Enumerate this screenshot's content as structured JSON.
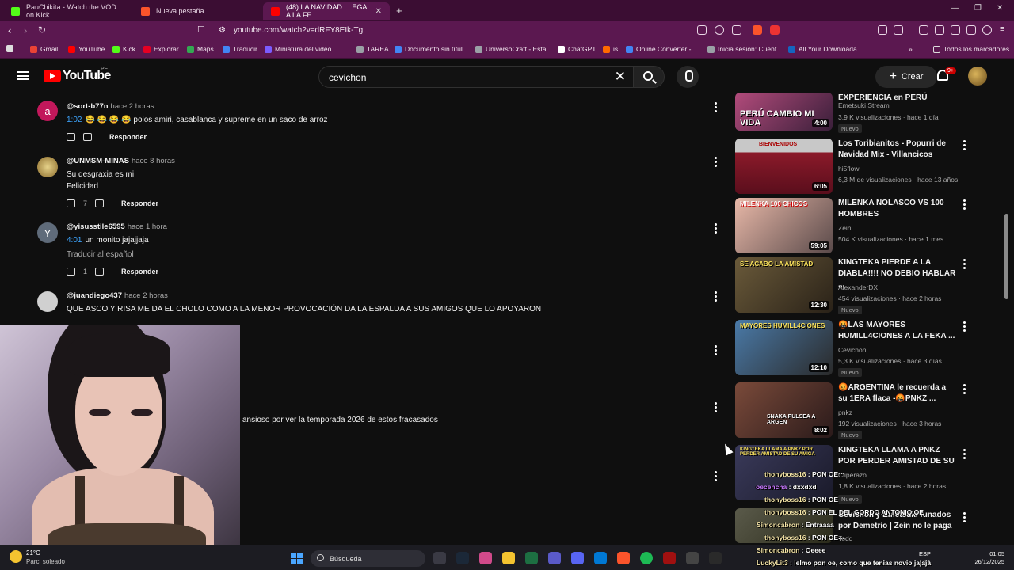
{
  "browser": {
    "tabs": [
      {
        "label": "PauChikita - Watch the VOD on Kick",
        "color": "#53fc18"
      },
      {
        "label": "Nueva pestaña",
        "color": "#fb542b"
      },
      {
        "label": "(48) LA NAVIDAD LLEGA A LA FE",
        "color": "#ff0000"
      }
    ],
    "url": "youtube.com/watch?v=dRFY8EIk-Tg",
    "bookmarks": [
      {
        "label": "Gmail",
        "color": "#ea4335"
      },
      {
        "label": "YouTube",
        "color": "#ff0000"
      },
      {
        "label": "Kick",
        "color": "#53fc18"
      },
      {
        "label": "Explorar",
        "color": "#e60023"
      },
      {
        "label": "Maps",
        "color": "#34a853"
      },
      {
        "label": "Traducir",
        "color": "#4285f4"
      },
      {
        "label": "Miniatura del video",
        "color": "#7b5cff"
      },
      {
        "label": "TAREA",
        "color": "#9aa0a6"
      },
      {
        "label": "Documento sin títul...",
        "color": "#4285f4"
      },
      {
        "label": "UniversoCraft - Esta...",
        "color": "#9aa0a6"
      },
      {
        "label": "ChatGPT",
        "color": "#ffffff"
      },
      {
        "label": "is",
        "color": "#ff6a00"
      },
      {
        "label": "Online Converter -...",
        "color": "#4285f4"
      },
      {
        "label": "Inicia sesión: Cuent...",
        "color": "#9aa0a6"
      },
      {
        "label": "All Your Downloada...",
        "color": "#1565c0"
      }
    ],
    "bookmarks_folder": "Todos los marcadores"
  },
  "youtube": {
    "logo_text": "YouTube",
    "country_code": "PE",
    "search_value": "cevichon",
    "create_label": "Crear",
    "notif_count": "9+"
  },
  "comments": [
    {
      "avatar_letter": "a",
      "avatar_color": "#c2185b",
      "user": "@sort-b77n",
      "ago": "hace 2 horas",
      "timestamp": "1:02",
      "text": "😂 😂 😂 😂 polos amiri, casablanca y supreme en un saco de arroz",
      "likes": "",
      "reply": "Responder"
    },
    {
      "avatar_letter": "",
      "avatar_color": "#b59a4a",
      "user": "@UNMSM-MINAS",
      "ago": "hace 8 horas",
      "line1": "Su desgraxia es mi",
      "line2": "Felicidad",
      "likes": "7",
      "reply": "Responder"
    },
    {
      "avatar_letter": "Y",
      "avatar_color": "#5f6b7a",
      "user": "@yisusstile6595",
      "ago": "hace 1 hora",
      "timestamp": "4:01",
      "text": "un monito jajajjaja",
      "translate": "Traducir al español",
      "likes": "1",
      "reply": "Responder"
    },
    {
      "avatar_letter": "",
      "avatar_color": "#d0d0d0",
      "user": "@juandiego437",
      "ago": "hace 2 horas",
      "text": "QUE ASCO Y RISA ME DA EL CHOLO COMO A LA MENOR PROVOCACIÓN DA LA ESPALDA A SUS AMIGOS QUE LO APOYARON",
      "reply": "Responder"
    },
    {
      "text": "ansioso por ver la temporada 2026 de estos fracasados"
    }
  ],
  "sidebar_videos": [
    {
      "title": "EXPERIENCIA en PERÚ",
      "channel": "Emetsuki Stream",
      "views": "3,9 K visualizaciones",
      "ago": "hace 1 día",
      "duration": "4:00",
      "badge": "Nuevo",
      "overlay": "PERÚ CAMBIO MI VIDA",
      "thumb": "#7a3d5a"
    },
    {
      "title": "Los Toribianitos - Popurri de Navidad Mix - Villancicos",
      "channel": "hi5flow",
      "views": "6,3 M de visualizaciones",
      "ago": "hace 13 años",
      "duration": "6:05",
      "badge": "",
      "overlay": "BIENVENIDOS",
      "thumb": "#8b1a2a"
    },
    {
      "title": "MILENKA NOLASCO VS 100 HOMBRES",
      "channel": "Zein",
      "views": "504 K visualizaciones",
      "ago": "hace 1 mes",
      "duration": "59:05",
      "badge": "",
      "overlay": "MILENKA 100 CHICOS",
      "thumb": "#b88a70"
    },
    {
      "title": "KINGTEKA PIERDE A LA DIABLA!!!! NO DEBIO HABLAR ...",
      "channel": "AlexanderDX",
      "views": "454 visualizaciones",
      "ago": "hace 2 horas",
      "duration": "12:30",
      "badge": "Nuevo",
      "overlay": "SE ACABO LA AMISTAD",
      "thumb": "#4a4030"
    },
    {
      "title": "🤬LAS MAYORES HUMILL4CIONES A LA FEKA ...",
      "channel": "Cevichon",
      "views": "5,3 K visualizaciones",
      "ago": "hace 3 días",
      "duration": "12:10",
      "badge": "Nuevo",
      "overlay": "MAYORES HUMILL4CIONES",
      "thumb": "#3a5a7a"
    },
    {
      "title": "😡ARGENTINA le recuerda a su 1ERA flaca -🤬PNKZ ...",
      "channel": "pnkz",
      "views": "192 visualizaciones",
      "ago": "hace 3 horas",
      "duration": "8:02",
      "badge": "Nuevo",
      "overlay": "SNAKA PULSEA A ARGEN",
      "thumb": "#5a3a3a"
    },
    {
      "title": "KINGTEKA LLAMA A PNKZ POR PERDER AMISTAD DE SU ...",
      "channel": "Cliperazo",
      "views": "1,8 K visualizaciones",
      "ago": "hace 2 horas",
      "duration": "",
      "badge": "Nuevo",
      "overlay": "KINGTEKA LLAMA A PNKZ POR PERDER AMISTAD DE SU AMIGA",
      "thumb": "#2a2a3a"
    },
    {
      "title": "Cevichon y Emetsuki funados por Demetrio | Zein no le paga ...",
      "channel": "Todd",
      "views": "",
      "ago": "",
      "duration": "",
      "badge": "",
      "overlay": "",
      "thumb": "#3a3a2a"
    }
  ],
  "chat": [
    {
      "user": "thonyboss16",
      "msg": "PON OE"
    },
    {
      "user": "oecencha",
      "msg": "dxxdxd"
    },
    {
      "user": "thonyboss16",
      "msg": "PON OE"
    },
    {
      "user": "thonyboss16",
      "msg": "PON EL DEL GORDO ANTONIO OE"
    },
    {
      "user": "Simoncabron",
      "msg": "Entraaaa"
    },
    {
      "user": "thonyboss16",
      "msg": "PON OE"
    },
    {
      "user": "Simoncabron",
      "msg": "Oeeee"
    },
    {
      "user": "LuckyLit3",
      "msg": "lelmo pon oe, como que tenias novio jajaja"
    }
  ],
  "taskbar": {
    "temp": "21°C",
    "condition": "Parc. soleado",
    "search": "Búsqueda",
    "lang1": "ESP",
    "lang2": "LAA",
    "time": "01:05",
    "date": "26/12/2025"
  }
}
